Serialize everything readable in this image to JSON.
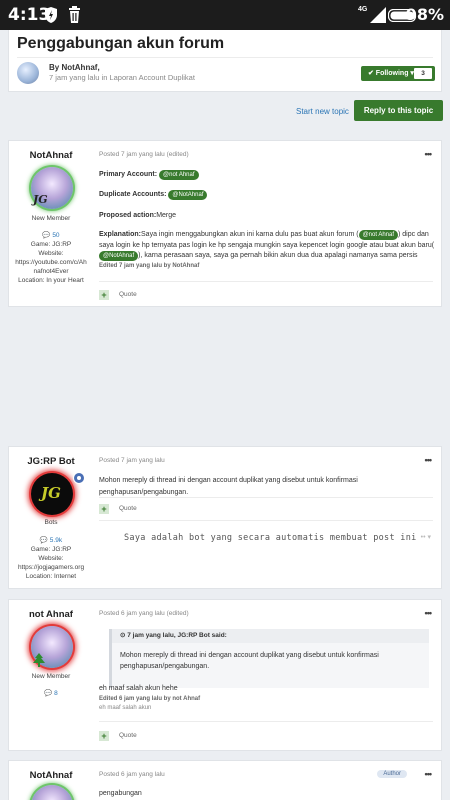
{
  "statusbar": {
    "time": "4:13",
    "network": "4G",
    "battery": "98%"
  },
  "topic": {
    "title": "Penggabungan akun forum",
    "by_line": "By NotAhnaf,",
    "meta_line": "7 jam yang lalu in Laporan Account Duplikat",
    "following_label": "✔ Following ▾",
    "following_count": "3"
  },
  "actions": {
    "start_topic": "Start new topic",
    "reply": "Reply to this topic"
  },
  "posts": [
    {
      "author": "NotAhnaf",
      "rank": "New Member",
      "posts_count": "💬 50",
      "game": "Game: JG:RP",
      "website_label": "Website:",
      "website_line1": "https://youtube.com/c/Ah",
      "website_line2": "nafnot4Ever",
      "location": "Location: In your Heart",
      "posted": "Posted 7 jam yang lalu (edited)",
      "primary_label": "Primary Account:",
      "primary_mention": "@not Ahnaf",
      "duplicate_label": "Duplicate Accounts:",
      "duplicate_mention": "@NotAhnaf",
      "proposed_label": "Proposed action:",
      "proposed_value": "Merge",
      "explanation_label": "Explanation:",
      "explanation_1": "Saya ingin menggabungkan akun ini karna dulu pas buat akun forum (",
      "explanation_mention1": "@not Ahnaf",
      "explanation_2": ") dipc dan saya login",
      "explanation_3": "ke hp ternyata pas login ke hp sengaja mungkin saya kepencet login google atau buat akun baru(",
      "explanation_mention2": "@NotAhnaf",
      "explanation_4": "), karna perasaan saya, saya ga pernah bikin akun dua dua apalagi namanya sama persis",
      "edited": "Edited 7 jam yang lalu by NotAhnaf",
      "plus": "+",
      "quote": "Quote"
    },
    {
      "author": "JG:RP Bot",
      "rank": "Bots",
      "posts_count": "💬 5.9k",
      "game": "Game: JG:RP",
      "website_label": "Website:",
      "website_line1": "https://jogjagamers.org",
      "location": "Location: Internet",
      "posted": "Posted 7 jam yang lalu",
      "text": "Mohon mereply di thread ini dengan account duplikat yang disebut untuk konfirmasi penghapusan/pengabungan.",
      "plus": "+",
      "quote": "Quote",
      "signature": "Saya adalah bot yang secara automatis membuat post ini",
      "avatar_text": "JG"
    },
    {
      "author": "not Ahnaf",
      "rank": "New Member",
      "posts_count": "💬 8",
      "posted": "Posted 6 jam yang lalu (edited)",
      "quote_head": "7 jam yang lalu, JG:RP Bot said:",
      "quote_text_1": "Mohon mereply di thread ini dengan account duplikat yang disebut untuk konfirmasi",
      "quote_text_2": "penghapusan/pengabungan.",
      "reply_text": "eh maaf salah akun hehe",
      "edited": "Edited 6 jam yang lalu by not Ahnaf",
      "edit_reason": "eh maaf salah akun",
      "plus": "+",
      "quote": "Quote"
    },
    {
      "author": "NotAhnaf",
      "posted": "Posted 6 jam yang lalu",
      "badge": "Author",
      "text": "pengabungan"
    }
  ],
  "more_label": "•••",
  "colors": {
    "accent_green": "#387a2d",
    "link_blue": "#2b75b5",
    "background": "#ebeef2"
  }
}
